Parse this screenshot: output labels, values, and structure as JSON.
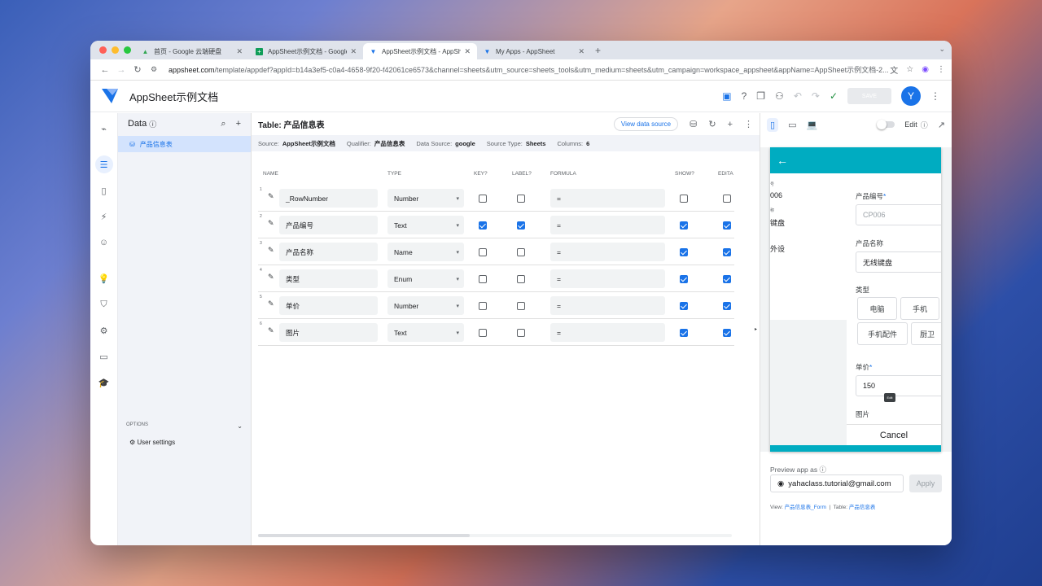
{
  "browser": {
    "tabs": [
      {
        "title": "首页 - Google 云端硬盘",
        "icon": "drive-icon"
      },
      {
        "title": "AppSheet示例文档 - Google 表格",
        "icon": "sheets-icon"
      },
      {
        "title": "AppSheet示例文档 - AppSheet",
        "icon": "appsheet-icon",
        "active": true
      },
      {
        "title": "My Apps - AppSheet",
        "icon": "appsheet-icon"
      }
    ],
    "url_host": "appsheet.com",
    "url_rest": "/template/appdef?appId=b14a3ef5-c0a4-4658-9f20-f42061ce6573&channel=sheets&utm_source=sheets_tools&utm_medium=sheets&utm_campaign=workspace_appsheet&appName=AppSheet示例文档-2..."
  },
  "app": {
    "title": "AppSheet示例文档",
    "save_label": "SAVE",
    "avatar_letter": "Y",
    "accent": "#1a73e8",
    "brand_teal": "#00acc1"
  },
  "data_panel": {
    "title": "Data",
    "tables": [
      "产品信息表"
    ],
    "options_label": "OPTIONS",
    "user_settings": "User settings"
  },
  "editor": {
    "title": "Table: 产品信息表",
    "view_source": "View data source",
    "meta": {
      "source_label": "Source:",
      "source": "AppSheet示例文档",
      "qualifier_label": "Qualifier:",
      "qualifier": "产品信息表",
      "datasource_label": "Data Source:",
      "datasource": "google",
      "sourcetype_label": "Source Type:",
      "sourcetype": "Sheets",
      "columns_label": "Columns:",
      "columns": "6"
    },
    "headers": [
      "NAME",
      "TYPE",
      "KEY?",
      "LABEL?",
      "FORMULA",
      "SHOW?",
      "EDITA"
    ],
    "rows": [
      {
        "num": "1",
        "name": "_RowNumber",
        "type": "Number",
        "key": false,
        "label": false,
        "formula": "=",
        "show": false,
        "edit": false
      },
      {
        "num": "2",
        "name": "产品编号",
        "type": "Text",
        "key": true,
        "label": true,
        "formula": "=",
        "show": true,
        "edit": true
      },
      {
        "num": "3",
        "name": "产品名称",
        "type": "Name",
        "key": false,
        "label": false,
        "formula": "=",
        "show": true,
        "edit": true
      },
      {
        "num": "4",
        "name": "类型",
        "type": "Enum",
        "key": false,
        "label": false,
        "formula": "=",
        "show": true,
        "edit": true
      },
      {
        "num": "5",
        "name": "单价",
        "type": "Number",
        "key": false,
        "label": false,
        "formula": "=",
        "show": true,
        "edit": true
      },
      {
        "num": "6",
        "name": "图片",
        "type": "Text",
        "key": false,
        "label": false,
        "formula": "=",
        "show": true,
        "edit": true
      }
    ]
  },
  "preview": {
    "edit_label": "Edit",
    "ghost": {
      "l1": "号",
      "v1": "006",
      "l2": "称",
      "v2": "键盘",
      "v3": "外设"
    },
    "form": {
      "f1_label": "产品编号",
      "f1_value": "CP006",
      "f2_label": "产品名称",
      "f2_value": "无线键盘",
      "f3_label": "类型",
      "chips": [
        "电脑",
        "手机",
        "手机配件",
        "厨卫"
      ],
      "f4_label": "单价",
      "f4_value": "150",
      "f5_label": "图片",
      "cancel": "Cancel",
      "edit_badge": "Edit"
    },
    "preview_as": "Preview app as",
    "email": "yahaclass.tutorial@gmail.com",
    "apply": "Apply",
    "view_label": "View:",
    "view_value": "产品信息表_Form",
    "table_label": "Table:",
    "table_value": "产品信息表"
  }
}
